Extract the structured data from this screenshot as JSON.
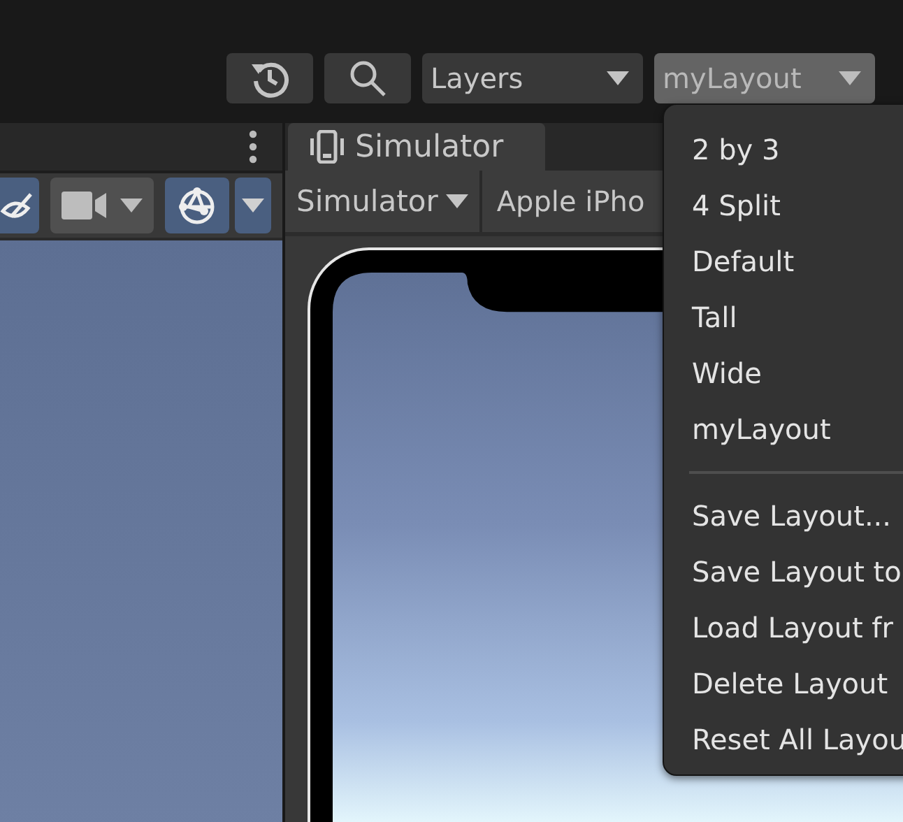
{
  "toolbar": {
    "layers_dropdown": {
      "label": "Layers"
    },
    "layout_dropdown": {
      "label": "myLayout",
      "open": true
    }
  },
  "scene_panel": {
    "tools": [
      {
        "kind": "visibility",
        "on": true
      },
      {
        "kind": "camera",
        "on": false
      },
      {
        "kind": "gizmos",
        "on": true
      }
    ]
  },
  "simulator_panel": {
    "tab": {
      "label": "Simulator",
      "selected": true
    },
    "mode_dropdown": "Simulator",
    "device_dropdown": "Apple iPho"
  },
  "layout_menu": {
    "items": [
      {
        "kind": "item",
        "label": "2 by 3"
      },
      {
        "kind": "item",
        "label": "4 Split"
      },
      {
        "kind": "item",
        "label": "Default"
      },
      {
        "kind": "item",
        "label": "Tall"
      },
      {
        "kind": "item",
        "label": "Wide"
      },
      {
        "kind": "item",
        "label": "myLayout"
      },
      {
        "kind": "separator"
      },
      {
        "kind": "item",
        "label": "Save Layout..."
      },
      {
        "kind": "item",
        "label": "Save Layout to"
      },
      {
        "kind": "item",
        "label": "Load Layout fr"
      },
      {
        "kind": "item",
        "label": "Delete Layout"
      },
      {
        "kind": "item",
        "label": "Reset All Layou"
      }
    ]
  }
}
